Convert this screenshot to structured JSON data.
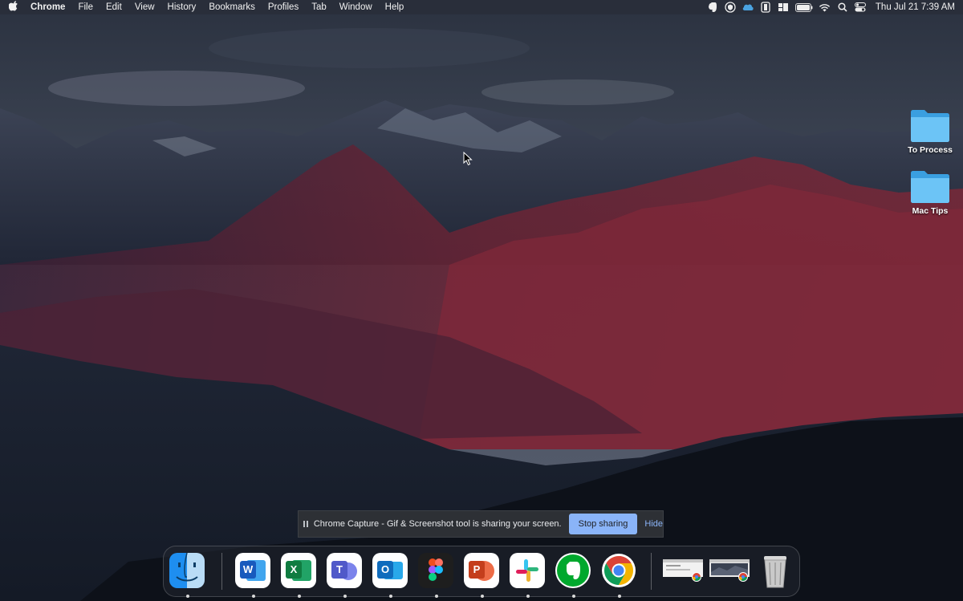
{
  "menubar": {
    "app_name": "Chrome",
    "menus": [
      "File",
      "Edit",
      "View",
      "History",
      "Bookmarks",
      "Profiles",
      "Tab",
      "Window",
      "Help"
    ],
    "clock": "Thu Jul 21  7:39 AM",
    "status_icons": [
      "evernote-icon",
      "vpn-shield-icon",
      "cloud-icon",
      "bartender-icon",
      "window-manager-icon",
      "battery-icon",
      "wifi-icon",
      "search-icon",
      "control-center-icon"
    ]
  },
  "desktop": {
    "folders": [
      {
        "label": "To Process"
      },
      {
        "label": "Mac Tips"
      }
    ]
  },
  "share_bar": {
    "message": "Chrome Capture - Gif & Screenshot tool is sharing your screen.",
    "stop_label": "Stop sharing",
    "hide_label": "Hide",
    "accent": "#8ab4f8"
  },
  "dock": {
    "apps": [
      {
        "name": "Finder",
        "running": true
      },
      {
        "name": "Microsoft Word",
        "letter": "W",
        "color": "#185abd",
        "running": true
      },
      {
        "name": "Microsoft Excel",
        "letter": "X",
        "color": "#107c41",
        "running": true
      },
      {
        "name": "Microsoft Teams",
        "letter": "T",
        "color": "#5059c9",
        "running": true
      },
      {
        "name": "Microsoft Outlook",
        "letter": "O",
        "color": "#0f6cbd",
        "running": true
      },
      {
        "name": "Figma",
        "running": true
      },
      {
        "name": "Microsoft PowerPoint",
        "letter": "P",
        "color": "#c43e1c",
        "running": true
      },
      {
        "name": "Slack",
        "running": true
      },
      {
        "name": "Evernote",
        "running": true
      },
      {
        "name": "Google Chrome",
        "running": true
      }
    ],
    "minimized": [
      "chrome-window-1",
      "chrome-window-2"
    ],
    "trash": "Trash"
  }
}
